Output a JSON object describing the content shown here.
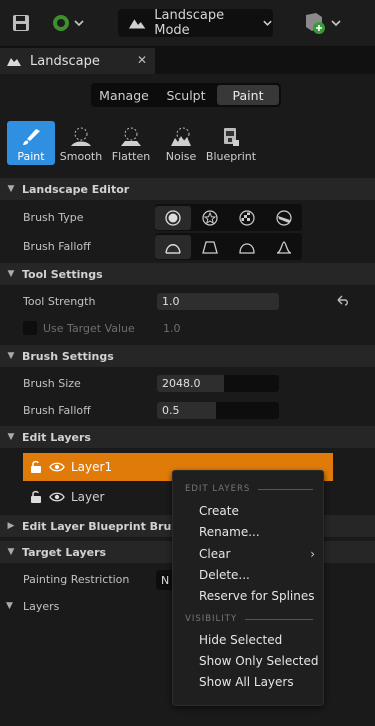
{
  "toolbar": {
    "mode_label": "Landscape Mode"
  },
  "tab": {
    "title": "Landscape"
  },
  "segments": [
    "Manage",
    "Sculpt",
    "Paint"
  ],
  "tools": [
    "Paint",
    "Smooth",
    "Flatten",
    "Noise",
    "Blueprint"
  ],
  "sections": {
    "landscape_editor": "Landscape Editor",
    "tool_settings": "Tool Settings",
    "brush_settings": "Brush Settings",
    "edit_layers": "Edit Layers",
    "edit_layer_bp": "Edit Layer Blueprint Brushes",
    "target_layers": "Target Layers",
    "layers": "Layers"
  },
  "landscape_editor": {
    "brush_type_label": "Brush Type",
    "brush_falloff_label": "Brush Falloff"
  },
  "tool_settings": {
    "tool_strength_label": "Tool Strength",
    "tool_strength_value": "1.0",
    "use_target_label": "Use Target Value",
    "use_target_value": "1.0"
  },
  "brush_settings": {
    "brush_size_label": "Brush Size",
    "brush_size_value": "2048.0",
    "brush_size_fill": 0.55,
    "brush_falloff_label": "Brush Falloff",
    "brush_falloff_value": "0.5",
    "brush_falloff_fill": 0.48
  },
  "layers": [
    {
      "name": "Layer1",
      "selected": true
    },
    {
      "name": "Layer",
      "selected": false
    }
  ],
  "target_layers": {
    "painting_restriction_label": "Painting Restriction",
    "painting_restriction_value": "N"
  },
  "context_menu": {
    "section1": "EDIT LAYERS",
    "items1": [
      "Create",
      "Rename...",
      "Clear",
      "Delete...",
      "Reserve for Splines"
    ],
    "section2": "VISIBILITY",
    "items2": [
      "Hide Selected",
      "Show Only Selected",
      "Show All Layers"
    ]
  },
  "colors": {
    "accent_blue": "#2f8fe0",
    "selection_orange": "#e07b0a"
  }
}
